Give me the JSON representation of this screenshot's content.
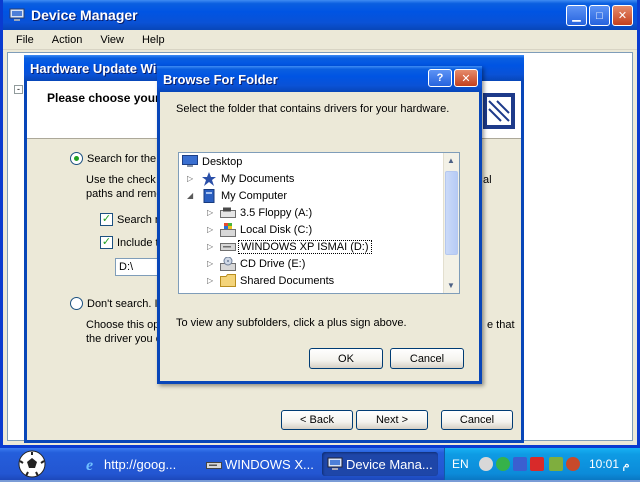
{
  "device_manager": {
    "title": "Device Manager",
    "menu": [
      "File",
      "Action",
      "View",
      "Help"
    ],
    "caption_buttons": [
      "minimize-icon",
      "maximize-icon",
      "close-icon"
    ]
  },
  "wizard": {
    "title": "Hardware Update Wi",
    "header_text": "Please choose your",
    "option_search_label": "Search for the b",
    "option_search_desc_line1": "Use the check",
    "option_search_desc_line2": "paths and remo",
    "option_search_desc_suffix": "al",
    "check_removable_label": "Search re",
    "check_include_label": "Include th",
    "path_value": "D:\\",
    "option_dont_search_label": "Don't search. I",
    "option_dont_search_desc_line1": "Choose this opt",
    "option_dont_search_desc_line2": "the driver you c",
    "option_dont_search_desc_suffix": "e that",
    "buttons": {
      "back": "< Back",
      "next": "Next >",
      "cancel": "Cancel"
    }
  },
  "browse_dialog": {
    "title": "Browse For Folder",
    "instruction": "Select the folder that contains drivers for your hardware.",
    "tree": [
      {
        "label": "Desktop",
        "icon": "desktop-icon",
        "expander": ""
      },
      {
        "label": "My Documents",
        "icon": "my-documents-icon",
        "expander": "▷"
      },
      {
        "label": "My Computer",
        "icon": "my-computer-icon",
        "expander": "◢"
      },
      {
        "label": "3.5 Floppy (A:)",
        "icon": "floppy-drive-icon",
        "expander": "▷"
      },
      {
        "label": "Local Disk (C:)",
        "icon": "local-disk-icon",
        "expander": "▷"
      },
      {
        "label": "WINDOWS XP ISMAI (D:)",
        "icon": "cd-drive-icon",
        "expander": "▷",
        "selected": true
      },
      {
        "label": "CD Drive (E:)",
        "icon": "cd-drive-icon",
        "expander": "▷"
      },
      {
        "label": "Shared Documents",
        "icon": "folder-icon",
        "expander": "▷"
      }
    ],
    "hint": "To view any subfolders, click a plus sign above.",
    "ok": "OK",
    "cancel": "Cancel",
    "help_button": "?",
    "close_button": "✕"
  },
  "taskbar": {
    "buttons": [
      {
        "label": "http://goog...",
        "icon": "ie-icon",
        "active": false
      },
      {
        "label": "WINDOWS X...",
        "icon": "cd-drive-icon",
        "active": false
      },
      {
        "label": "Device Mana...",
        "icon": "device-manager-icon",
        "active": true
      }
    ],
    "language": "EN",
    "clock": "10:01 م"
  },
  "colors": {
    "titlebar": "#0054e3",
    "dialog_bg": "#ece9d8",
    "taskbar": "#245edb",
    "tray": "#0e9be4"
  }
}
